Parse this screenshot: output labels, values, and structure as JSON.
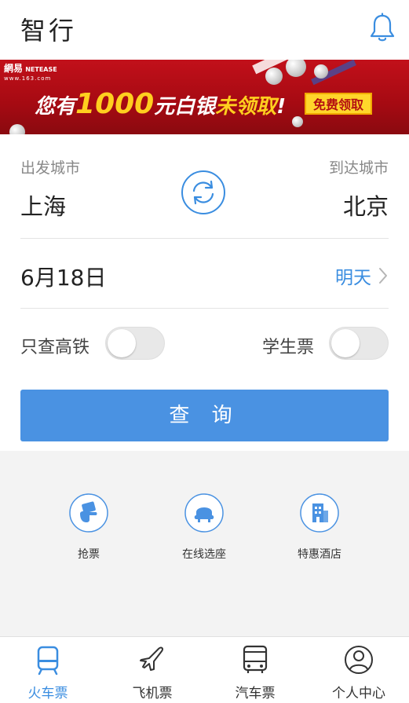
{
  "header": {
    "title": "智行",
    "bell_icon": "bell-icon"
  },
  "banner": {
    "brand_cn": "網易",
    "brand_en": "NETEASE",
    "brand_url": "www.163.com",
    "text_prefix": "您有",
    "amount": "1000",
    "text_middle": "元白银",
    "text_highlight": "未领取",
    "text_exclaim": "!",
    "cta": "免费领取",
    "colors": {
      "background": "#b50d16",
      "highlight": "#ffcf1f"
    }
  },
  "search": {
    "from_label": "出发城市",
    "from_city": "上海",
    "to_label": "到达城市",
    "to_city": "北京",
    "swap_icon": "swap-icon",
    "date": "6月18日",
    "day": "明天",
    "gaotie_label": "只查高铁",
    "gaotie_on": false,
    "student_label": "学生票",
    "student_on": false,
    "query_button": "查 询",
    "accent": "#4a92e2"
  },
  "services": [
    {
      "label": "抢票",
      "icon": "grab-ticket-icon"
    },
    {
      "label": "在线选座",
      "icon": "seat-select-icon"
    },
    {
      "label": "特惠酒店",
      "icon": "hotel-icon"
    }
  ],
  "tabbar": {
    "items": [
      {
        "label": "火车票",
        "icon": "train-icon",
        "active": true
      },
      {
        "label": "飞机票",
        "icon": "plane-icon",
        "active": false
      },
      {
        "label": "汽车票",
        "icon": "bus-icon",
        "active": false
      },
      {
        "label": "个人中心",
        "icon": "profile-icon",
        "active": false
      }
    ],
    "active_color": "#3a8de0"
  }
}
